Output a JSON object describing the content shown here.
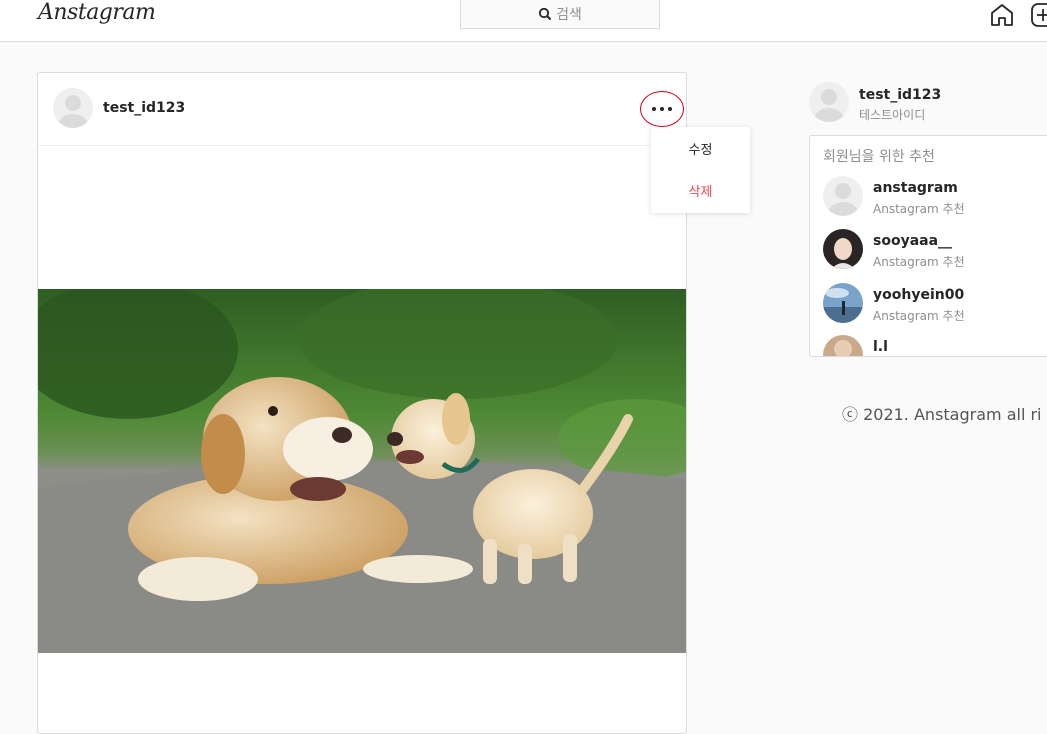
{
  "nav": {
    "logo": "Anstagram",
    "search_placeholder": "검색",
    "icons": [
      "home-icon",
      "new-post-icon"
    ]
  },
  "post": {
    "username": "test_id123",
    "more_icon": "more-options-icon",
    "menu": {
      "edit": "수정",
      "delete": "삭제"
    },
    "image": "dog-photo"
  },
  "sidebar": {
    "me": {
      "username": "test_id123",
      "name": "테스트아이디"
    },
    "suggest_title": "회원님을 위한 추천",
    "suggestions": [
      {
        "username": "anstagram",
        "sub": "Anstagram 추천"
      },
      {
        "username": "sooyaaa__",
        "sub": "Anstagram 추천"
      },
      {
        "username": "yoohyein00",
        "sub": "Anstagram 추천"
      },
      {
        "username": "l.l",
        "sub": ""
      }
    ],
    "footer": "ⓒ 2021. Anstagram all ri"
  },
  "colors": {
    "accent_red": "#ed4956",
    "highlight_ring": "#d0021b",
    "border": "#dbdbdb"
  }
}
